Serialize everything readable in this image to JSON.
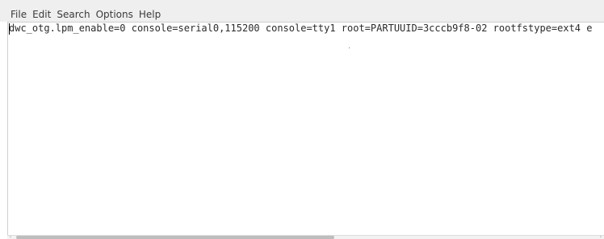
{
  "menubar": {
    "items": [
      {
        "label": "File"
      },
      {
        "label": "Edit"
      },
      {
        "label": "Search"
      },
      {
        "label": "Options"
      },
      {
        "label": "Help"
      }
    ]
  },
  "editor": {
    "content": "dwc_otg.lpm_enable=0 console=serial0,115200 console=tty1 root=PARTUUID=3cccb9f8-02 rootfstype=ext4 e"
  },
  "scrollbar": {
    "left_arrow_icon": "chevron-left-icon",
    "right_arrow_icon": "chevron-right-icon",
    "left_arrow_glyph": "‹",
    "right_arrow_glyph": "›"
  },
  "colors": {
    "menubar_bg": "#efefef",
    "editor_bg": "#ffffff",
    "text": "#2b2b2b"
  }
}
